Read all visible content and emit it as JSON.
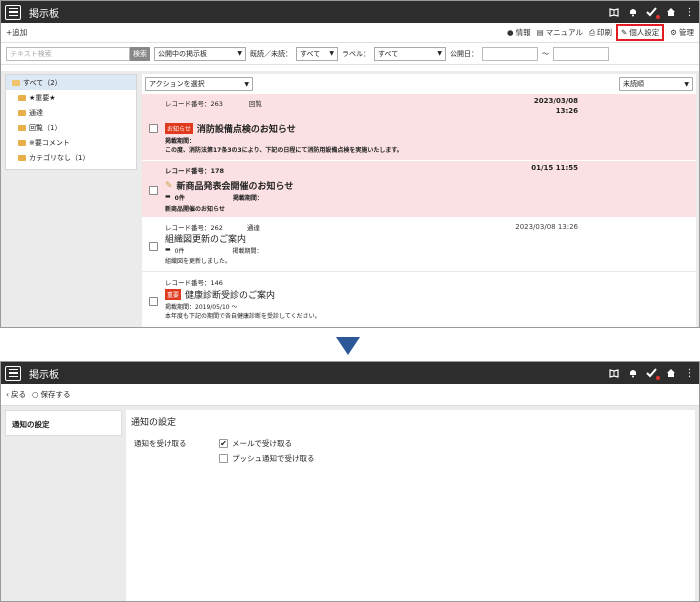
{
  "app_title": "掲示板",
  "colors": {
    "titlebar": "#2d2d2d",
    "highlight_box": "#e31b23",
    "pink_row": "#fbe1e3",
    "arrow": "#2b5797",
    "tag": "#e03a1e"
  },
  "top": {
    "toolbar": {
      "add": "+追加",
      "info": "情報",
      "manual": "マニュアル",
      "print": "印刷",
      "personal_settings": "個人設定",
      "admin": "管理"
    },
    "filters": {
      "search_placeholder": "テキスト検索",
      "search_button": "検索",
      "board_select": "公開中の掲示板",
      "read_label": "既読／未読：",
      "read_value": "すべて",
      "label_label": "ラベル：",
      "label_value": "すべて",
      "date_label": "公開日：",
      "range_sep": "～"
    },
    "folders": [
      {
        "label": "すべて（2）",
        "level": 0,
        "selected": true
      },
      {
        "label": "★重要★",
        "level": 1
      },
      {
        "label": "通達",
        "level": 1
      },
      {
        "label": "回覧（1）",
        "level": 1
      },
      {
        "label": "※要コメント",
        "level": 1
      },
      {
        "label": "カテゴリなし（1）",
        "level": 1
      }
    ],
    "action_select": "アクションを選択",
    "sort_select": "未読順",
    "items": [
      {
        "record": "レコード番号：263",
        "category": "回覧",
        "date": "2023/03/08",
        "time": "13:26",
        "tag": "お知らせ",
        "title": "消防設備点検のお知らせ",
        "period": "掲載期間：",
        "body": "この度、消防法第17条3の3により、下記の日程にて消防用設備点検を実施いたします。"
      },
      {
        "record": "レコード番号：178",
        "date": "01/15 11:55",
        "title": "新商品発表会開催のお知らせ",
        "comments": "0件",
        "period": "掲載期間：",
        "body": "新商品開催のお知らせ"
      },
      {
        "record": "レコード番号：262",
        "category": "通達",
        "date": "2023/03/08 13:26",
        "title": "組織図更新のご案内",
        "comments": "0件",
        "period": "掲載期間：",
        "body": "組織図を更新しました。"
      },
      {
        "record": "レコード番号：146",
        "tag": "重要",
        "title": "健康診断受診のご案内",
        "period": "掲載期間：2019/05/10 ～",
        "body": "本年度も下記の期間で各自健康診断を受診してください。"
      }
    ]
  },
  "bottom": {
    "back": "戻る",
    "save": "保存する",
    "side_item": "通知の設定",
    "section_title": "通知の設定",
    "receive_label": "通知を受け取る",
    "options": [
      {
        "label": "メールで受け取る",
        "checked": true
      },
      {
        "label": "プッシュ通知で受け取る",
        "checked": false
      }
    ]
  }
}
